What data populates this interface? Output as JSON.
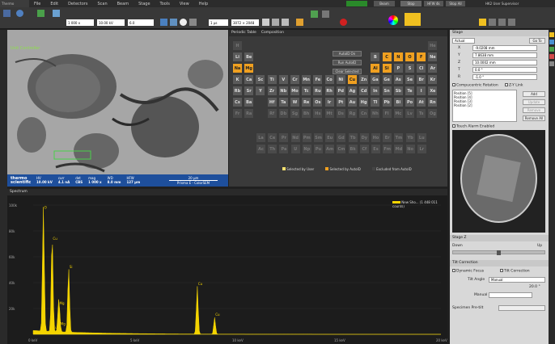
{
  "menu": {
    "app": "Thermo Scientific",
    "items": [
      "File",
      "Edit",
      "Detectors",
      "Scan",
      "Beam",
      "Stage",
      "Tools",
      "View",
      "Help"
    ]
  },
  "toolbar": {
    "mag": "1 000 x",
    "hv": "10.00 kV",
    "spot": "6.0",
    "dwell": "1 µs",
    "res": "3072 × 2048",
    "beam_on": "Beam",
    "stop": "Stop",
    "hfw": "HFW 4k",
    "fov": "Stop All",
    "user": "HK2 User Supervisor",
    "status": "FEI  Idle"
  },
  "image": {
    "label": "Unit Controller",
    "databar": {
      "logo": "thermo scientific",
      "fields": [
        {
          "h": "HV",
          "v": "10.00 kV"
        },
        {
          "h": "curr",
          "v": "4.1 nA"
        },
        {
          "h": "det",
          "v": "CBS"
        },
        {
          "h": "mag",
          "v": "1 000 x"
        },
        {
          "h": "WD",
          "v": "8.0 mm"
        },
        {
          "h": "HFW",
          "v": "127 µm"
        }
      ],
      "scale": "20 µm",
      "name": "Prisma E - ColorSEM"
    }
  },
  "periodic": {
    "tabs": [
      "Periodic Table",
      "Composition"
    ],
    "buttons": [
      "AutoID On",
      "Run AutoID",
      "Clear Selected"
    ],
    "legend": [
      "Selected by User",
      "Selected by AutoID",
      "Excluded from AutoID"
    ],
    "rows": [
      [
        "H",
        "",
        "",
        "",
        "",
        "",
        "",
        "",
        "",
        "",
        "",
        "",
        "",
        "",
        "",
        "",
        "",
        "He"
      ],
      [
        "Li",
        "Be",
        "",
        "",
        "",
        "",
        "",
        "",
        "",
        "",
        "",
        "",
        "B",
        "C",
        "N",
        "O",
        "F",
        "Ne"
      ],
      [
        "Na",
        "Mg",
        "",
        "",
        "",
        "",
        "",
        "",
        "",
        "",
        "",
        "",
        "Al",
        "Si",
        "P",
        "S",
        "Cl",
        "Ar"
      ],
      [
        "K",
        "Ca",
        "Sc",
        "Ti",
        "V",
        "Cr",
        "Mn",
        "Fe",
        "Co",
        "Ni",
        "Cu",
        "Zn",
        "Ga",
        "Ge",
        "As",
        "Se",
        "Br",
        "Kr"
      ],
      [
        "Rb",
        "Sr",
        "Y",
        "Zr",
        "Nb",
        "Mo",
        "Tc",
        "Ru",
        "Rh",
        "Pd",
        "Ag",
        "Cd",
        "In",
        "Sn",
        "Sb",
        "Te",
        "I",
        "Xe"
      ],
      [
        "Cs",
        "Ba",
        "",
        "Hf",
        "Ta",
        "W",
        "Re",
        "Os",
        "Ir",
        "Pt",
        "Au",
        "Hg",
        "Tl",
        "Pb",
        "Bi",
        "Po",
        "At",
        "Rn"
      ],
      [
        "Fr",
        "Ra",
        "",
        "Rf",
        "Db",
        "Sg",
        "Bh",
        "Hs",
        "Mt",
        "Ds",
        "Rg",
        "Cn",
        "Nh",
        "Fl",
        "Mc",
        "Lv",
        "Ts",
        "Og"
      ]
    ],
    "lanth": [
      "La",
      "Ce",
      "Pr",
      "Nd",
      "Pm",
      "Sm",
      "Eu",
      "Gd",
      "Tb",
      "Dy",
      "Ho",
      "Er",
      "Tm",
      "Yb",
      "Lu"
    ],
    "actin": [
      "Ac",
      "Th",
      "Pa",
      "U",
      "Np",
      "Pu",
      "Am",
      "Cm",
      "Bk",
      "Cf",
      "Es",
      "Fm",
      "Md",
      "No",
      "Lr"
    ],
    "selected": [
      "Mg",
      "O",
      "C",
      "Al",
      "Si",
      "Cu",
      "N",
      "F",
      "Na"
    ]
  },
  "spectrum": {
    "title": "Spectrum",
    "legend": "New Sho... (1 448 011 counts)",
    "yticks": [
      "100k",
      "80k",
      "60k",
      "40k",
      "20k"
    ],
    "xticks": [
      "0 keV",
      "5 keV",
      "10 keV",
      "15 keV",
      "20 keV"
    ],
    "peaks": [
      {
        "label": "O",
        "pct": 96
      },
      {
        "label": "Cu",
        "pct": 72
      },
      {
        "label": "Si",
        "pct": 50
      },
      {
        "label": "Cu",
        "pct": 37
      },
      {
        "label": "Mg",
        "pct": 22
      },
      {
        "label": "Cu",
        "pct": 13
      },
      {
        "label": "Mg",
        "pct": 6
      },
      {
        "label": "Cu",
        "pct": 3
      }
    ]
  },
  "stage": {
    "title": "Stage",
    "mode": "Actual",
    "goto": "Go To",
    "x": "-9.0208 mm",
    "y": "7.8638 mm",
    "z": "10.0002 mm",
    "t": "0.0 °",
    "r": "-1.0 °",
    "comp": "Compucentric Rotation",
    "link": "Z-Y Link",
    "positions": [
      "Position [5]",
      "Position [4]",
      "Position [3]",
      "Position [2]"
    ],
    "add": "Add",
    "update": "Update",
    "remove": "Remove",
    "remove_all": "Remove All",
    "nav_title": "Touch Alarm Enabled",
    "stagez": "Stage Z",
    "down": "Down",
    "up": "Up",
    "tilt_title": "Tilt Correction",
    "dyn": "Dynamic Focus",
    "tiltc": "Tilt Correction",
    "tilt_angle_label": "Tilt Angle",
    "tilt_angle": "Manual",
    "tilt_val": "20.0 °",
    "manual": "Manual",
    "specimen": "Specimen Pre-tilt"
  },
  "colors": {
    "accent": "#f0a020",
    "spectrum": "#f4d400",
    "databar": "#1e4f9c"
  }
}
